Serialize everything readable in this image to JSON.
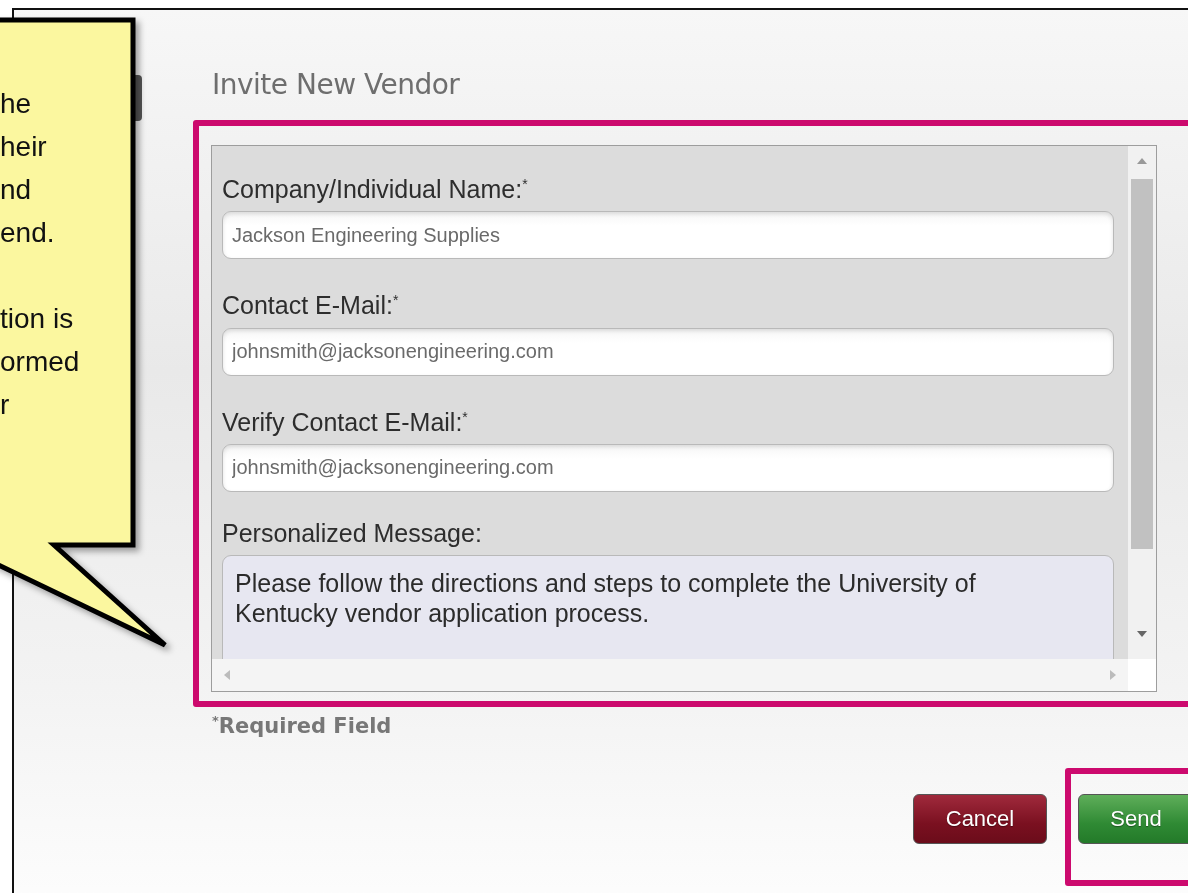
{
  "callout": {
    "paragraphs": [
      [
        "he",
        "heir",
        "nd",
        "end."
      ],
      [
        "tion is",
        "ormed",
        "r"
      ]
    ]
  },
  "dialog": {
    "title": "Invite New Vendor",
    "fields": [
      {
        "kind": "input",
        "label": "Company/Individual Name:$^{*}$",
        "value": "Jackson Engineering Supplies"
      },
      {
        "kind": "input",
        "label": "Contact E-Mail:$^{*}$",
        "value": "johnsmith@jacksonengineering.com"
      },
      {
        "kind": "input",
        "label": "Verify Contact E-Mail:$^{*}$",
        "value": "johnsmith@jacksonengineering.com"
      },
      {
        "kind": "textarea",
        "label": "Personalized Message:",
        "value": "Please follow the directions and steps to complete the University of Kentucky vendor application process."
      }
    ],
    "required_note": "$^{*}$Required Field",
    "buttons": [
      {
        "kind": "cancel",
        "label": "Cancel",
        "highlighted": false
      },
      {
        "kind": "send",
        "label": "Send",
        "highlighted": true
      }
    ]
  }
}
